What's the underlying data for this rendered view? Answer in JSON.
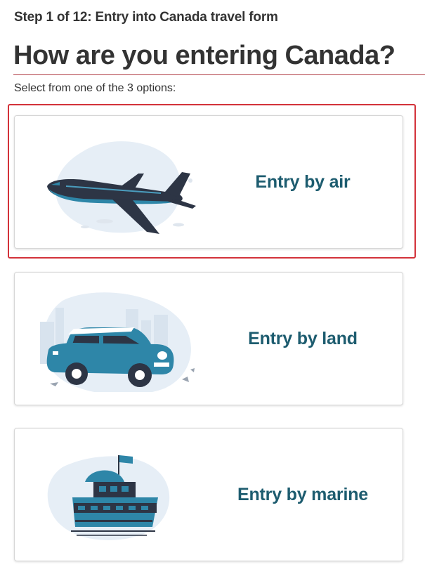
{
  "header": {
    "step_label": "Step 1 of 12: Entry into Canada travel form",
    "title": "How are you entering Canada?",
    "instructions": "Select from one of the 3 options:"
  },
  "options": [
    {
      "label": "Entry by air",
      "icon": "airplane-illustration",
      "selected": true
    },
    {
      "label": "Entry by land",
      "icon": "car-illustration",
      "selected": false
    },
    {
      "label": "Entry by marine",
      "icon": "ship-illustration",
      "selected": false
    }
  ],
  "colors": {
    "heading_text": "#333333",
    "rule": "#af3c43",
    "option_text": "#1d5c6f",
    "selection_outline": "#d3323a",
    "illustration_blue": "#2e86a8",
    "illustration_navy": "#2d3545",
    "illustration_bg": "#e6eef6"
  }
}
